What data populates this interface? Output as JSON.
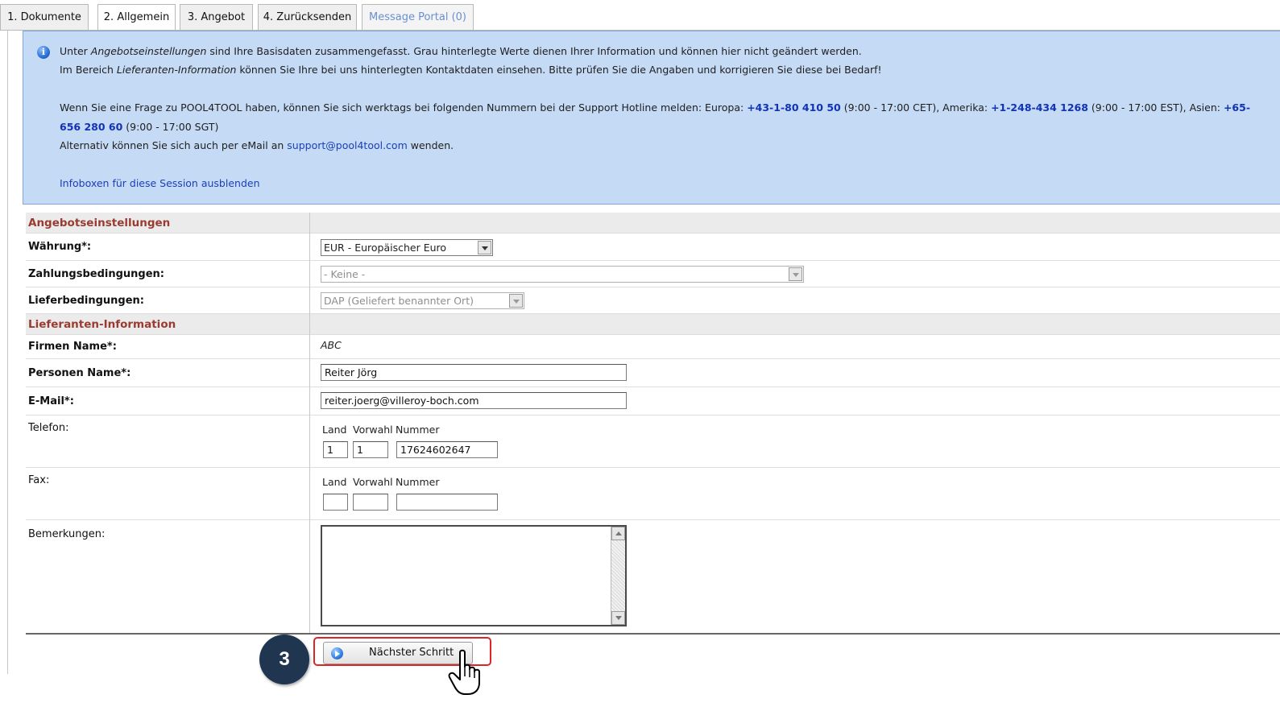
{
  "tabs": [
    {
      "label": "1. Dokumente"
    },
    {
      "label": "2. Allgemein"
    },
    {
      "label": "3. Angebot"
    },
    {
      "label": "4. Zurücksenden"
    },
    {
      "label": "Message Portal (0)"
    }
  ],
  "info": {
    "line1_prefix": "Unter ",
    "line1_em": "Angebotseinstellungen",
    "line1_suffix": " sind Ihre Basisdaten zusammengefasst. Grau hinterlegte Werte dienen Ihrer Information und können hier nicht geändert werden.",
    "line2_prefix": "Im Bereich ",
    "line2_em": "Lieferanten-Information",
    "line2_suffix": " können Sie Ihre bei uns hinterlegten Kontaktdaten einsehen. Bitte prüfen Sie die Angaben und korrigieren Sie diese bei Bedarf!",
    "line3_a": "Wenn Sie eine Frage zu POOL4TOOL haben, können Sie sich werktags bei folgenden Nummern bei der Support Hotline melden: Europa: ",
    "phone_europe": "+43-1-80 410 50",
    "line3_b": " (9:00 - 17:00 CET), Amerika: ",
    "phone_america": "+1-248-434 1268",
    "line3_c": " (9:00 - 17:00 EST), Asien: ",
    "phone_asia_part1": "+65-",
    "phone_asia_part2": "656 280 60",
    "line4_suffix": " (9:00 - 17:00 SGT)",
    "line5_prefix": "Alternativ können Sie sich auch per eMail an ",
    "email": "support@pool4tool.com",
    "line5_suffix": " wenden.",
    "hide_link": "Infoboxen für diese Session ausblenden"
  },
  "form": {
    "section_offer": "Angebotseinstellungen",
    "currency_label": "Währung*:",
    "currency_value": "EUR - Europäischer Euro",
    "payment_label": "Zahlungsbedingungen:",
    "payment_value": "- Keine -",
    "delivery_label": "Lieferbedingungen:",
    "delivery_value": "DAP (Geliefert benannter Ort)",
    "section_supplier": "Lieferanten-Information",
    "company_label": "Firmen Name*:",
    "company_value": "ABC",
    "person_label": "Personen Name*:",
    "person_value": "Reiter Jörg",
    "email_label": "E-Mail*:",
    "email_value": "reiter.joerg@villeroy-boch.com",
    "phone_label": "Telefon:",
    "phone_sub": {
      "land": "Land",
      "vorwahl": "Vorwahl",
      "nummer": "Nummer"
    },
    "phone_values": {
      "land": "1",
      "vorwahl": "1",
      "nummer": "17624602647"
    },
    "fax_label": "Fax:",
    "fax_sub": {
      "land": "Land",
      "vorwahl": "Vorwahl",
      "nummer": "Nummer"
    },
    "fax_values": {
      "land": "",
      "vorwahl": "",
      "nummer": ""
    },
    "remarks_label": "Bemerkungen:",
    "remarks_value": ""
  },
  "footer": {
    "next_button": "Nächster Schritt",
    "step_number": "3"
  },
  "icons": {
    "info": "info-icon",
    "next": "arrow-circle-icon",
    "cursor": "hand-pointer-icon"
  },
  "colors": {
    "info_bg": "#c5daf5",
    "section_label": "#9a3b32",
    "phone_link": "#1233b3",
    "highlight": "#d9262b",
    "step_badge": "#1f3550"
  }
}
